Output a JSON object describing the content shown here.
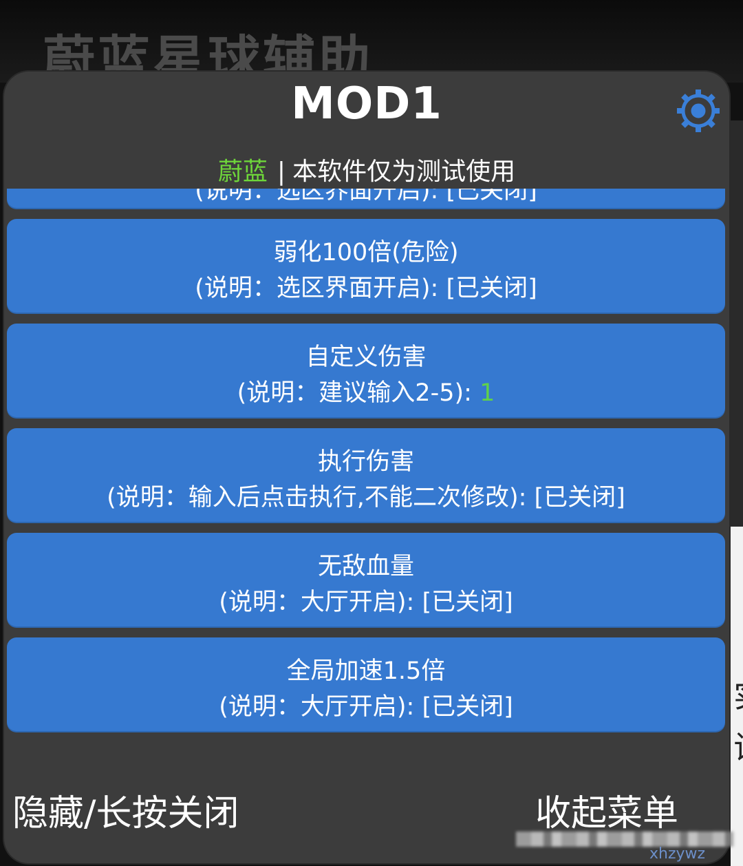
{
  "background": {
    "app_title": "蔚蓝星球辅助"
  },
  "menu": {
    "title": "MOD1",
    "settings_icon": "gear-icon",
    "subtitle": {
      "brand": "蔚蓝",
      "separator": "|",
      "notice": "本软件仅为测试使用"
    },
    "features": [
      {
        "name": "弱化100倍(危险)",
        "desc_prefix": "(说明：选区界面开启):",
        "status": "[已关闭]"
      },
      {
        "name": "自定义伤害",
        "desc_prefix": "(说明：建议输入2-5):",
        "value": "1"
      },
      {
        "name": "执行伤害",
        "desc_prefix": "(说明：输入后点击执行,不能二次修改):",
        "status": "[已关闭]"
      },
      {
        "name": "无敌血量",
        "desc_prefix": "(说明：大厅开启):",
        "status": "[已关闭]"
      },
      {
        "name": "全局加速1.5倍",
        "desc_prefix": "(说明：大厅开启):",
        "status": "[已关闭]"
      }
    ],
    "footer": {
      "hide_label": "隐藏/长按关闭",
      "collapse_label": "收起菜单"
    },
    "colors": {
      "panel_bg": "#3c3c3c",
      "item_bg": "#3679d0",
      "accent_green": "#6ed63a",
      "gear_blue": "#3a7fd8"
    }
  },
  "watermark": "xhzywz"
}
